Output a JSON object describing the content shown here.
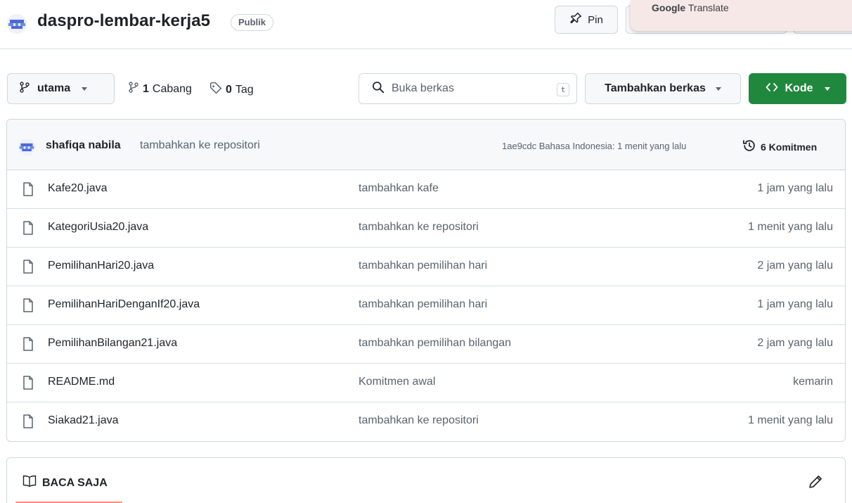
{
  "repo": {
    "name": "daspro-lembar-kerja5",
    "visibility": "Publik",
    "pin_label": "Pin"
  },
  "google_translate": {
    "brand": "Google",
    "product": "Translate"
  },
  "toolbar": {
    "branch_name": "utama",
    "branch_count": "1",
    "branch_label": "Cabang",
    "tag_count": "0",
    "tag_label": "Tag",
    "search_placeholder": "Buka berkas",
    "search_shortcut": "t",
    "add_file_label": "Tambahkan berkas",
    "code_label": "Kode"
  },
  "latest_commit": {
    "author": "shafiqa nabila",
    "message": "tambahkan ke repositori",
    "meta": "1ae9cdc Bahasa Indonesia: 1 menit yang lalu",
    "commit_count": "6 Komitmen"
  },
  "files": [
    {
      "name": "Kafe20.java",
      "commit": "tambahkan kafe",
      "time": "1 jam yang lalu"
    },
    {
      "name": "KategoriUsia20.java",
      "commit": "tambahkan ke repositori",
      "time": "1 menit yang lalu"
    },
    {
      "name": "PemilihanHari20.java",
      "commit": "tambahkan pemilihan hari",
      "time": "2 jam yang lalu"
    },
    {
      "name": "PemilihanHariDenganIf20.java",
      "commit": "tambahkan pemilihan hari",
      "time": "1 jam yang lalu"
    },
    {
      "name": "PemilihanBilangan21.java",
      "commit": "tambahkan pemilihan bilangan",
      "time": "2 jam yang lalu"
    },
    {
      "name": "README.md",
      "commit": "Komitmen awal",
      "time": "kemarin"
    },
    {
      "name": "Siakad21.java",
      "commit": "tambahkan ke repositori",
      "time": "1 menit yang lalu"
    }
  ],
  "readme": {
    "tab_label": "BACA SAJA"
  },
  "colors": {
    "primary_green": "#1f883d",
    "readme_underline": "#fd8c73",
    "muted_text": "#59636e"
  }
}
